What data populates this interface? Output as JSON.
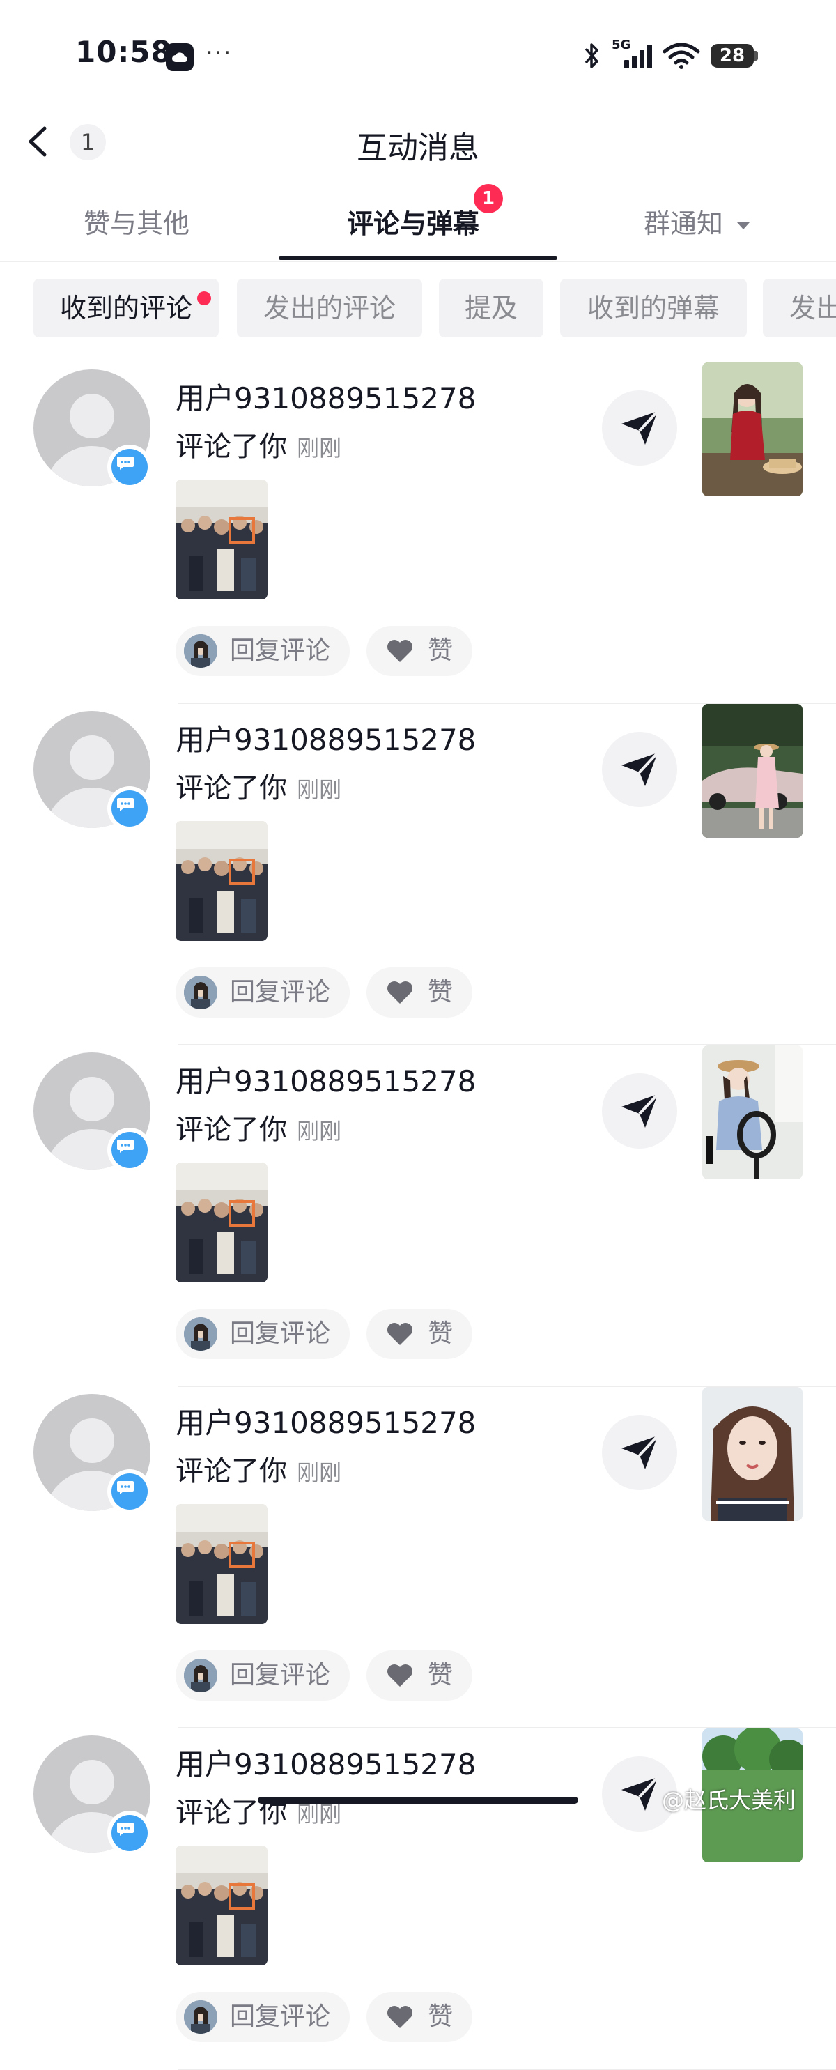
{
  "status_bar": {
    "time": "10:58",
    "network": "5G",
    "battery": "28"
  },
  "header": {
    "back_count": "1",
    "title": "互动消息"
  },
  "tabs": [
    {
      "label": "赞与其他",
      "active": false
    },
    {
      "label": "评论与弹幕",
      "active": true,
      "badge": "1"
    },
    {
      "label": "群通知",
      "active": false,
      "dropdown": true
    }
  ],
  "chips": [
    {
      "label": "收到的评论",
      "active": true,
      "dot": true
    },
    {
      "label": "发出的评论",
      "active": false
    },
    {
      "label": "提及",
      "active": false
    },
    {
      "label": "收到的弹幕",
      "active": false
    },
    {
      "label": "发出",
      "active": false
    }
  ],
  "items": [
    {
      "username": "用户9310889515278",
      "action": "评论了你",
      "time": "刚刚",
      "reply_label": "回复评论",
      "like_label": "赞",
      "post_thumb": "woman-red-top-cafe"
    },
    {
      "username": "用户9310889515278",
      "action": "评论了你",
      "time": "刚刚",
      "reply_label": "回复评论",
      "like_label": "赞",
      "post_thumb": "woman-car-street"
    },
    {
      "username": "用户9310889515278",
      "action": "评论了你",
      "time": "刚刚",
      "reply_label": "回复评论",
      "like_label": "赞",
      "post_thumb": "woman-hat-ringlight"
    },
    {
      "username": "用户9310889515278",
      "action": "评论了你",
      "time": "刚刚",
      "reply_label": "回复评论",
      "like_label": "赞",
      "post_thumb": "woman-selfie-portrait"
    },
    {
      "username": "用户9310889515278",
      "action": "评论了你",
      "time": "刚刚",
      "reply_label": "回复评论",
      "like_label": "赞",
      "post_thumb": "green-trees"
    }
  ],
  "watermark": "@赵氏大美利",
  "colors": {
    "accent_red": "#fe2c55",
    "comment_blue": "#3ea3f5",
    "text_primary": "#161823",
    "text_secondary": "#8a8b91"
  }
}
